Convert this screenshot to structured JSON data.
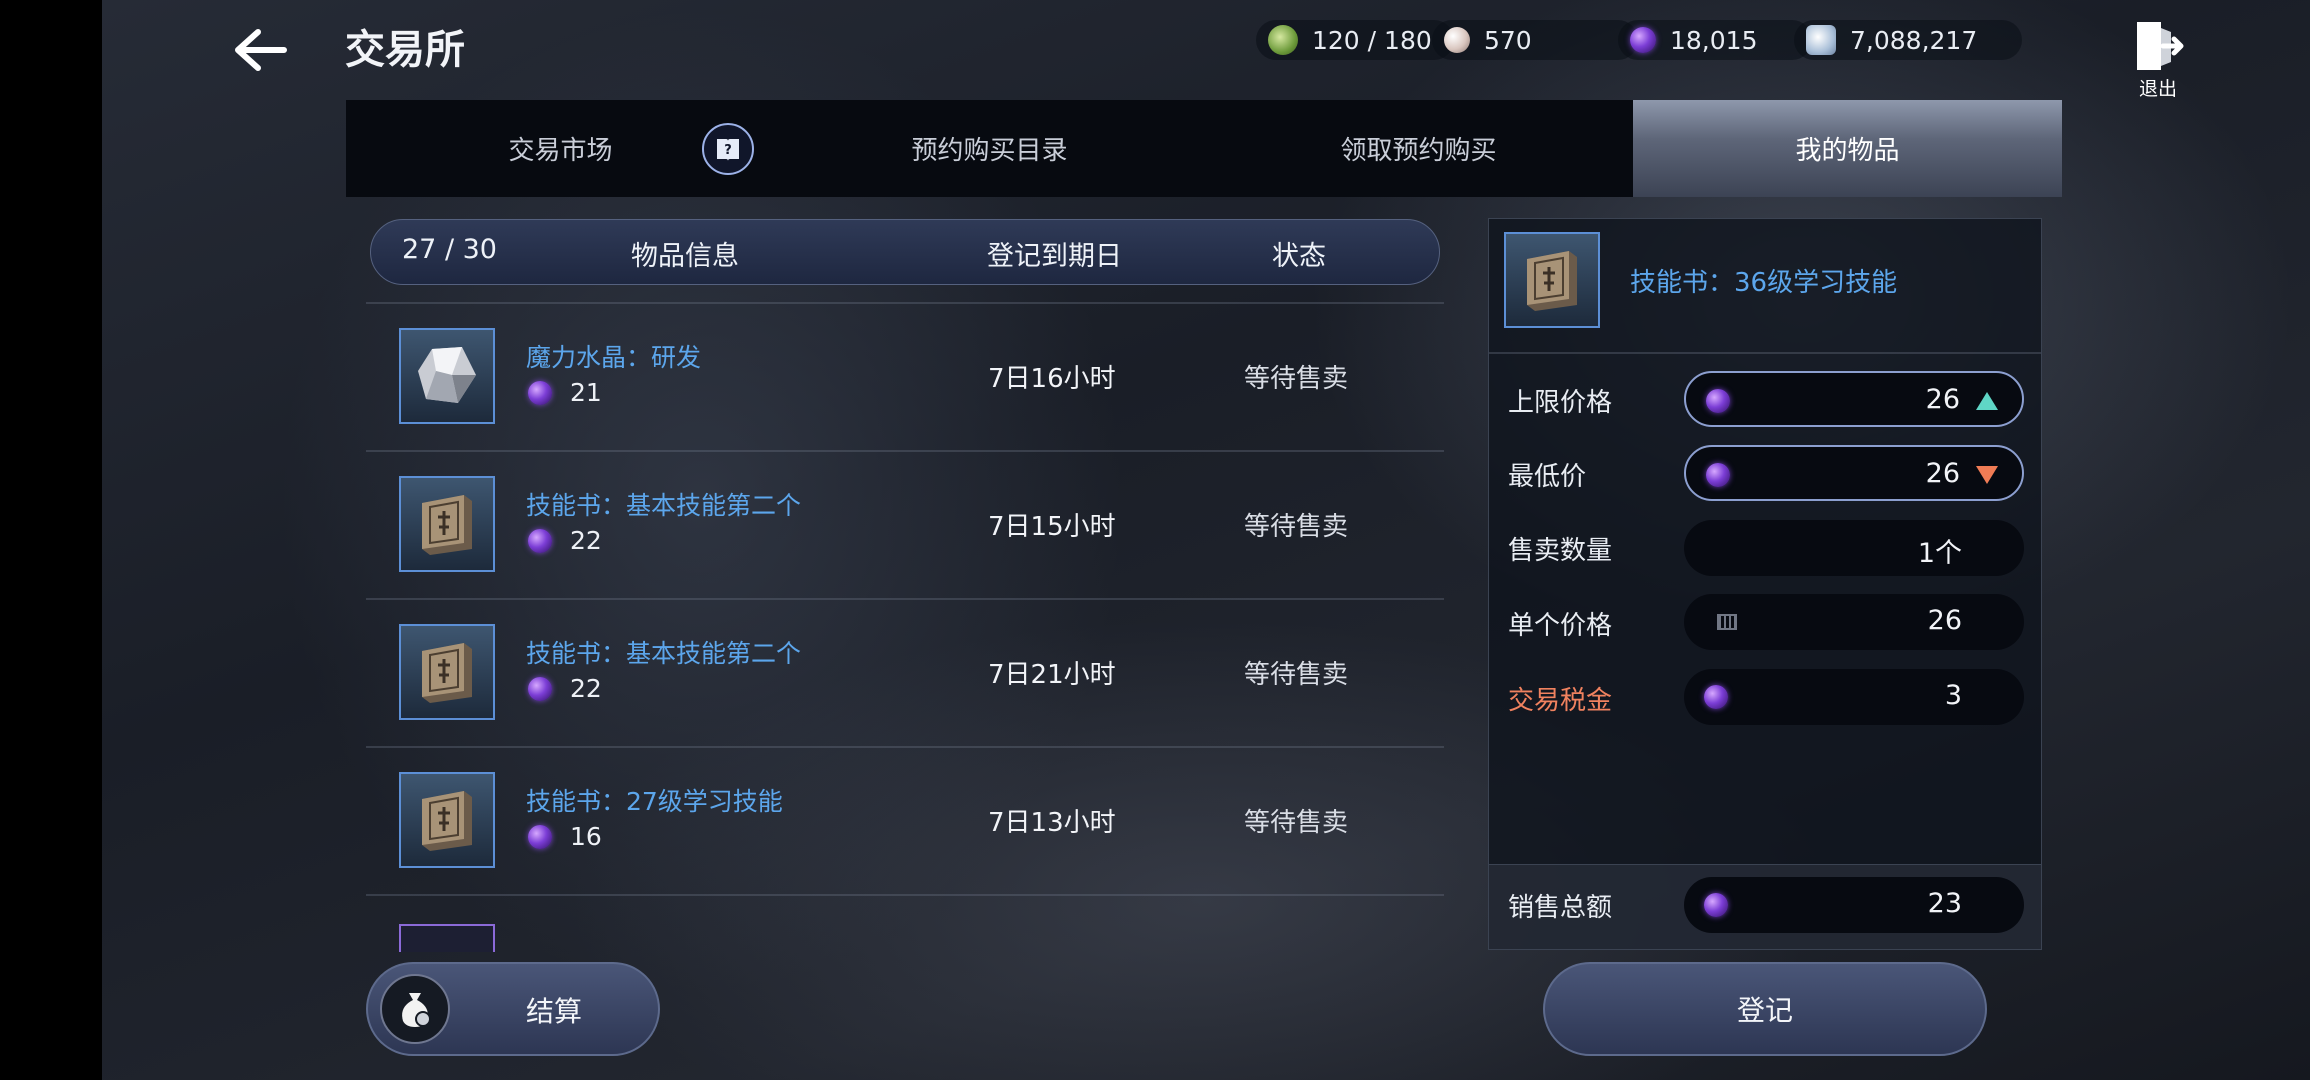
{
  "header": {
    "title": "交易所",
    "resources": [
      {
        "icon": "stamina-icon",
        "value": "120 / 180",
        "color": "#8fbf5a"
      },
      {
        "icon": "pearl-icon",
        "value": "570",
        "color": "#d9c9c0"
      },
      {
        "icon": "purple-diamond-icon",
        "value": "18,015",
        "color": "#7c3ed6"
      },
      {
        "icon": "silver-coin-icon",
        "value": "7,088,217",
        "color": "#b9cbe0"
      }
    ],
    "exit_label": "退出"
  },
  "tabs": [
    {
      "label": "交易市场",
      "active": false
    },
    {
      "label": "预约购买目录",
      "active": false
    },
    {
      "label": "领取预约购买",
      "active": false
    },
    {
      "label": "我的物品",
      "active": true
    }
  ],
  "list": {
    "count": "27 / 30",
    "col_item": "物品信息",
    "col_expiry": "登记到期日",
    "col_status": "状态",
    "items": [
      {
        "name": "魔力水晶：研发",
        "price": "21",
        "expiry": "7日16小时",
        "status": "等待售卖",
        "icon": "crystal-icon"
      },
      {
        "name": "技能书：基本技能第二个",
        "price": "22",
        "expiry": "7日15小时",
        "status": "等待售卖",
        "icon": "skill-book-icon"
      },
      {
        "name": "技能书：基本技能第二个",
        "price": "22",
        "expiry": "7日21小时",
        "status": "等待售卖",
        "icon": "skill-book-icon"
      },
      {
        "name": "技能书：27级学习技能",
        "price": "16",
        "expiry": "7日13小时",
        "status": "等待售卖",
        "icon": "skill-book-icon"
      }
    ]
  },
  "panel": {
    "item_name": "技能书：36级学习技能",
    "fields": {
      "max_price_label": "上限价格",
      "max_price": "26",
      "min_price_label": "最低价",
      "min_price": "26",
      "quantity_label": "售卖数量",
      "quantity": "1个",
      "unit_price_label": "单个价格",
      "unit_price": "26",
      "tax_label": "交易税金",
      "tax": "3",
      "total_label": "销售总额",
      "total": "23"
    }
  },
  "buttons": {
    "settle": "结算",
    "register": "登记"
  }
}
